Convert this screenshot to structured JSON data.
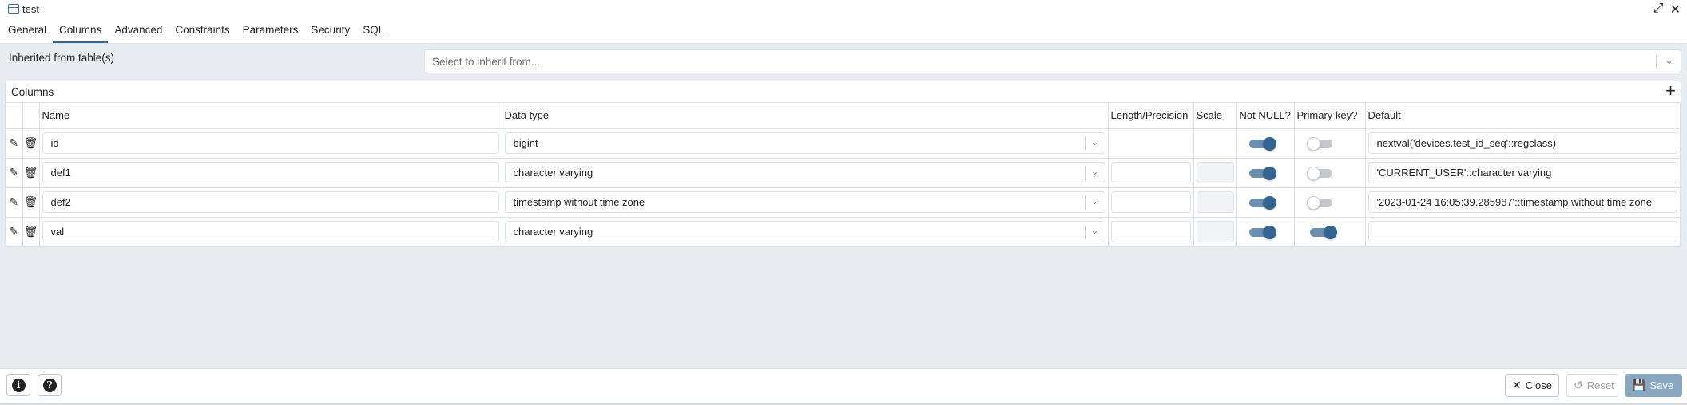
{
  "window": {
    "title": "test",
    "expand_icon": "expand-icon",
    "close_icon": "close-icon"
  },
  "tabs": [
    {
      "label": "General"
    },
    {
      "label": "Columns"
    },
    {
      "label": "Advanced"
    },
    {
      "label": "Constraints"
    },
    {
      "label": "Parameters"
    },
    {
      "label": "Security"
    },
    {
      "label": "SQL"
    }
  ],
  "active_tab": "Columns",
  "inherit": {
    "label": "Inherited from table(s)",
    "placeholder": "Select to inherit from..."
  },
  "columns_panel": {
    "title": "Columns",
    "headers": {
      "name": "Name",
      "data_type": "Data type",
      "length": "Length/Precision",
      "scale": "Scale",
      "not_null": "Not NULL?",
      "primary_key": "Primary key?",
      "default": "Default"
    },
    "rows": [
      {
        "name": "id",
        "data_type": "bigint",
        "length": "",
        "scale": "",
        "not_null": true,
        "primary_key": false,
        "default": "nextval('devices.test_id_seq'::regclass)"
      },
      {
        "name": "def1",
        "data_type": "character varying",
        "length": "",
        "scale": "",
        "not_null": true,
        "primary_key": false,
        "default": "'CURRENT_USER'::character varying"
      },
      {
        "name": "def2",
        "data_type": "timestamp without time zone",
        "length": "",
        "scale": "",
        "not_null": true,
        "primary_key": false,
        "default": "'2023-01-24 16:05:39.285987'::timestamp without time zone"
      },
      {
        "name": "val",
        "data_type": "character varying",
        "length": "",
        "scale": "",
        "not_null": true,
        "primary_key": true,
        "default": ""
      }
    ]
  },
  "footer": {
    "close_label": "Close",
    "reset_label": "Reset",
    "save_label": "Save"
  },
  "colors": {
    "accent": "#326690",
    "save_bg": "#8aa7c2",
    "bg": "#e8ebef"
  }
}
